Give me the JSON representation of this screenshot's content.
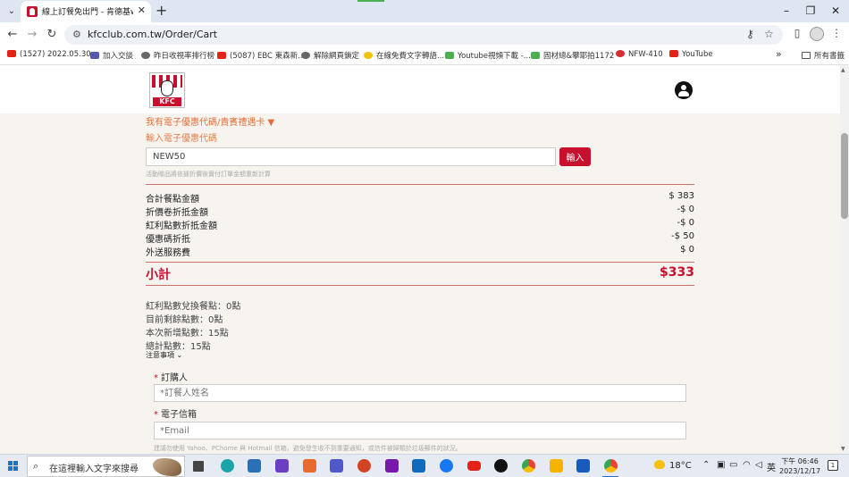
{
  "browser": {
    "tab_title": "線上訂餐免出門 - 肯德基www.k",
    "tab_close": "✕",
    "new_tab": "+",
    "url": "kfcclub.com.tw/Order/Cart",
    "bookmarks": [
      "(1527) 2022.05.30...",
      "加入交談",
      "昨日收視率排行榜",
      "(5087) EBC 東森新...",
      "解除網頁鎖定",
      "在線免費文字轉語...",
      "Youtube視頻下載 -...",
      "固材總&攀耶拍1172",
      "NFW-410",
      "YouTube"
    ],
    "bookmarks_more": "»",
    "bookmarks_folder": "所有書籤"
  },
  "cart": {
    "promo_toggle": "我有電子優惠代碼/貴賓禮遇卡 ▼",
    "promo_label": "輸入電子優惠代碼",
    "promo_code": "NEW50",
    "apply_button": "輸入",
    "promo_note": "活動贈品將依據折價後實付訂單金額重新計算",
    "summary": [
      {
        "label": "合計餐點金額",
        "value": "$ 383"
      },
      {
        "label": "折價卷折抵金額",
        "value": "-$ 0"
      },
      {
        "label": "紅利點數折抵金額",
        "value": "-$ 0"
      },
      {
        "label": "優惠碼折抵",
        "value": "-$ 50"
      },
      {
        "label": "外送服務費",
        "value": "$ 0"
      }
    ],
    "subtotal_label": "小計",
    "subtotal_value": "$333",
    "points": [
      "紅利點數兌換餐點：0點",
      "目前剩餘點數：0點",
      "本次新增點數：15點",
      "總計點數：15點"
    ],
    "notes_toggle": "注意事項 ⌄",
    "form": {
      "buyer_label": "訂購人",
      "buyer_placeholder": "*訂餐人姓名",
      "email_label": "電子信箱",
      "email_placeholder": "*Email",
      "required_mark": "*",
      "email_note": "建議勿使用 Yahoo、PChome 與 Hotmail 信箱，避免發生收不到重要通知，或信件被歸類於垃圾郵件的狀況。"
    }
  },
  "taskbar": {
    "search_placeholder": "在這裡輸入文字來搜尋",
    "weather": "18°C",
    "ime": "英",
    "time": "下午 06:46",
    "date": "2023/12/17",
    "notifications": "1"
  }
}
